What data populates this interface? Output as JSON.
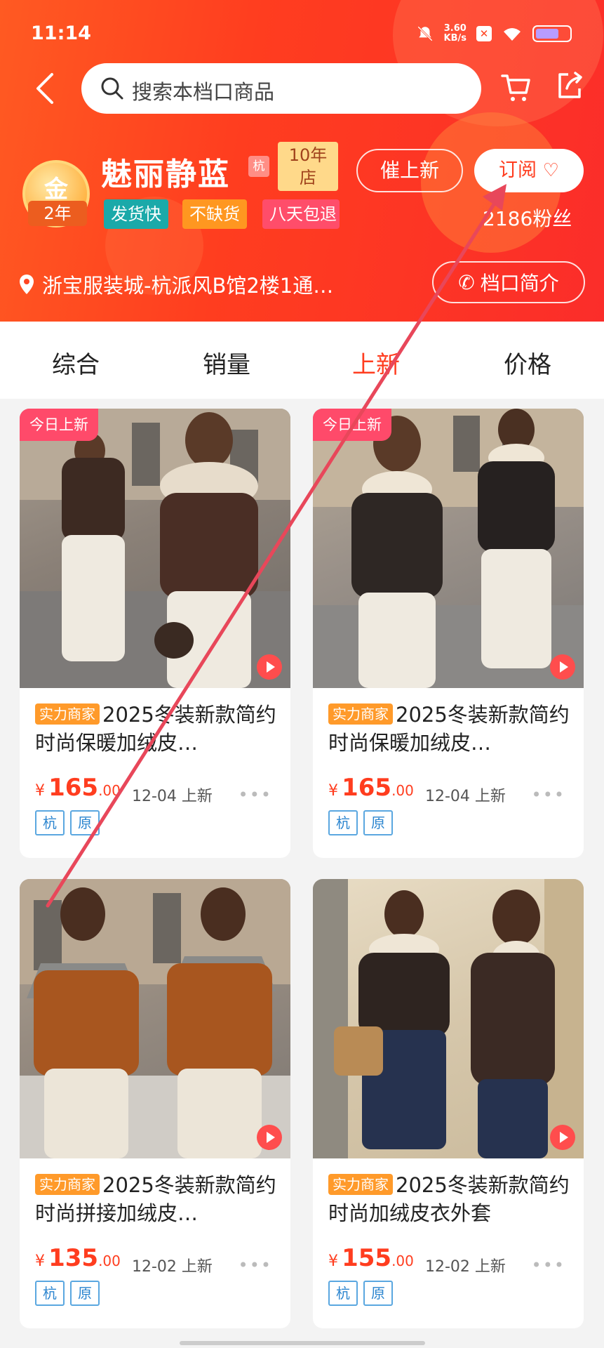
{
  "status_bar": {
    "time": "11:14",
    "speed_value": "3.60",
    "speed_unit": "KB/s"
  },
  "search": {
    "placeholder": "搜索本档口商品"
  },
  "shop": {
    "medal_char": "金",
    "medal_years": "2年",
    "name": "魅丽静蓝",
    "city_tag": "杭",
    "years_badge_line1": "10年",
    "years_badge_line2": "店",
    "chips": [
      "发货快",
      "不缺货",
      "八天包退"
    ],
    "urge_button": "催上新",
    "subscribe_button": "订阅",
    "fans": "2186粉丝",
    "location": "浙宝服装城-杭派风B馆2楼1通…",
    "intro_button": "档口简介"
  },
  "tabs": [
    {
      "label": "综合",
      "active": false
    },
    {
      "label": "销量",
      "active": false
    },
    {
      "label": "上新",
      "active": true
    },
    {
      "label": "价格",
      "active": false
    }
  ],
  "products": [
    {
      "new_badge": "今日上新",
      "seller_label": "实力商家",
      "title": "2025冬装新款简约时尚保暖加绒皮…",
      "currency": "¥",
      "price_int": "165",
      "price_dec": ".00",
      "date": "12-04 上新",
      "tags": [
        "杭",
        "原"
      ]
    },
    {
      "new_badge": "今日上新",
      "seller_label": "实力商家",
      "title": "2025冬装新款简约时尚保暖加绒皮…",
      "currency": "¥",
      "price_int": "165",
      "price_dec": ".00",
      "date": "12-04 上新",
      "tags": [
        "杭",
        "原"
      ]
    },
    {
      "new_badge": "",
      "seller_label": "实力商家",
      "title": "2025冬装新款简约时尚拼接加绒皮…",
      "currency": "¥",
      "price_int": "135",
      "price_dec": ".00",
      "date": "12-02 上新",
      "tags": [
        "杭",
        "原"
      ]
    },
    {
      "new_badge": "",
      "seller_label": "实力商家",
      "title": "2025冬装新款简约时尚加绒皮衣外套",
      "currency": "¥",
      "price_int": "155",
      "price_dec": ".00",
      "date": "12-02 上新",
      "tags": [
        "杭",
        "原"
      ]
    }
  ],
  "colors": {
    "brand": "#ff3d1f",
    "teal_chip": "#1aa9a9",
    "orange_chip": "#ff9720",
    "pink_chip": "#ff4d6a",
    "annotation_arrow": "#e8475a"
  }
}
